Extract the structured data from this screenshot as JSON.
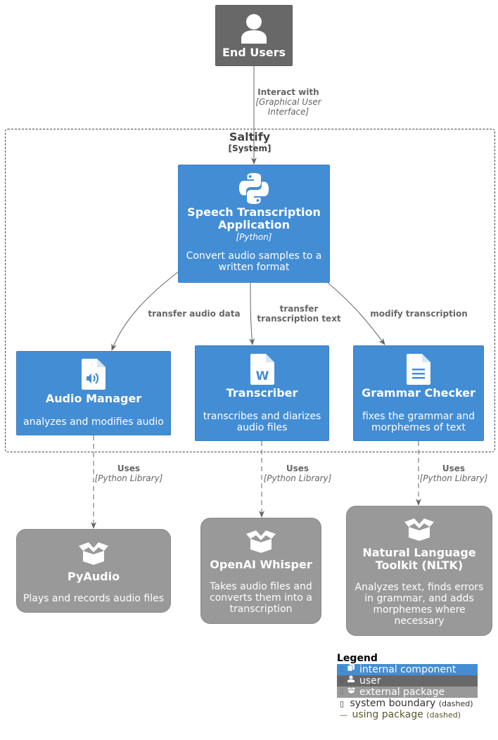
{
  "diagram": {
    "people": [
      {
        "id": "end_users",
        "title": "End Users",
        "icon": "person-icon"
      }
    ],
    "boundary": {
      "name": "Saltify",
      "type": "[System]"
    },
    "containers": [
      {
        "id": "speech_app",
        "title_line1": "Speech Transcription",
        "title_line2": "Application",
        "technology": "[Python]",
        "desc_line1": "Convert audio samples to a",
        "desc_line2": "written format",
        "icon": "python-icon"
      },
      {
        "id": "audio_manager",
        "title": "Audio Manager",
        "desc_line1": "analyzes and modifies audio",
        "icon": "audio-file-icon"
      },
      {
        "id": "transcriber",
        "title": "Transcriber",
        "desc_line1": "transcribes and diarizes",
        "desc_line2": "audio files",
        "icon": "word-file-icon"
      },
      {
        "id": "grammar_checker",
        "title": "Grammar Checker",
        "desc_line1": "fixes the grammar and",
        "desc_line2": "morphemes of text",
        "icon": "text-file-icon"
      }
    ],
    "external": [
      {
        "id": "pyaudio",
        "title": "PyAudio",
        "desc_line1": "Plays and records audio files",
        "icon": "package-icon"
      },
      {
        "id": "whisper",
        "title": "OpenAI Whisper",
        "desc_line1": "Takes audio files and",
        "desc_line2": "converts them into a",
        "desc_line3": "transcription",
        "icon": "package-icon"
      },
      {
        "id": "nltk",
        "title_line1": "Natural Language",
        "title_line2": "Toolkit (NLTK)",
        "desc_line1": "Analyzes text, finds errors",
        "desc_line2": "in grammar, and adds",
        "desc_line3": "morphemes where",
        "desc_line4": "necessary",
        "icon": "package-icon"
      }
    ],
    "relations": [
      {
        "from": "end_users",
        "to": "speech_app",
        "label": "Interact with",
        "tech_line1": "[Graphical User",
        "tech_line2": "Interface]",
        "style": "solid"
      },
      {
        "from": "speech_app",
        "to": "audio_manager",
        "label": "transfer audio data",
        "style": "solid"
      },
      {
        "from": "speech_app",
        "to": "transcriber",
        "label_line1": "transfer",
        "label_line2": "transcription text",
        "style": "solid"
      },
      {
        "from": "speech_app",
        "to": "grammar_checker",
        "label": "modify transcription",
        "style": "solid"
      },
      {
        "from": "audio_manager",
        "to": "pyaudio",
        "label": "Uses",
        "tech": "[Python Library]",
        "style": "dashed"
      },
      {
        "from": "transcriber",
        "to": "whisper",
        "label": "Uses",
        "tech": "[Python Library]",
        "style": "dashed"
      },
      {
        "from": "grammar_checker",
        "to": "nltk",
        "label": "Uses",
        "tech": "[Python Library]",
        "style": "dashed"
      }
    ]
  },
  "legend": {
    "title": "Legend",
    "items": [
      {
        "label": "internal component",
        "color": "#438dd5",
        "icon": "component-icon"
      },
      {
        "label": "user",
        "color": "#686868",
        "icon": "person-icon"
      },
      {
        "label": "external package",
        "color": "#999999",
        "icon": "package-icon"
      }
    ],
    "boundary_item": {
      "label": "system boundary",
      "note": "(dashed)",
      "glyph": "▯"
    },
    "relation_item": {
      "label": "using package",
      "note": "(dashed)",
      "glyph": "—"
    }
  },
  "colors": {
    "internal": "#438dd5",
    "user": "#686868",
    "external": "#999999",
    "edge": "#666666",
    "boundary": "#444444",
    "legend_relation_text": "#5b5a2e"
  }
}
